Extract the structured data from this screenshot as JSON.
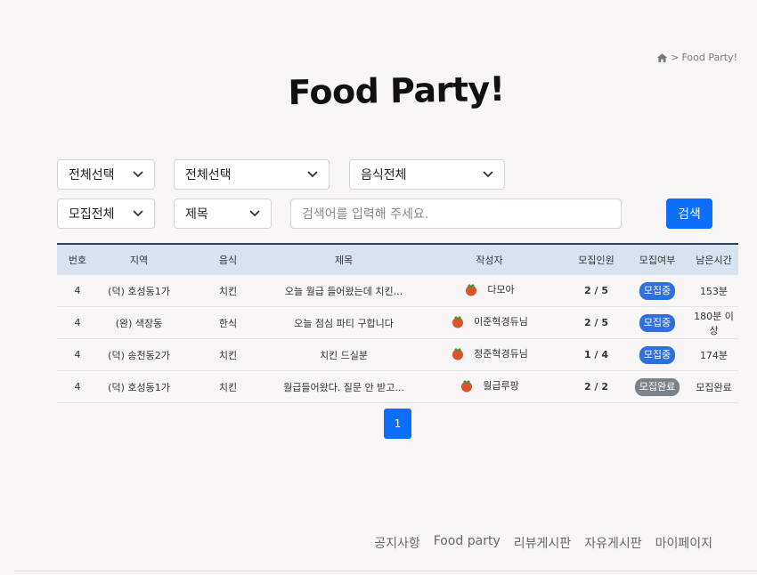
{
  "breadcrumb": {
    "separator": ">",
    "current": "Food Party!"
  },
  "page_title": "Food Party!",
  "filters": {
    "region1": "전체선택",
    "region2": "전체선택",
    "food": "음식전체",
    "recruit": "모집전체",
    "search_field": "제목",
    "search_placeholder": "검색어를 입력해 주세요.",
    "search_button": "검색"
  },
  "table": {
    "headers": [
      "번호",
      "지역",
      "음식",
      "제목",
      "작성자",
      "모집인원",
      "모집여부",
      "남은시간"
    ],
    "rows": [
      {
        "no": "4",
        "region": "(덕) 호성동1가",
        "food": "치킨",
        "title": "오늘 월급 들어왔는데 치킨...",
        "author": "다모아",
        "count": "2 / 5",
        "status": "모집중",
        "remaining": "153분"
      },
      {
        "no": "4",
        "region": "(완) 색장동",
        "food": "한식",
        "title": "오늘 점심 파티 구합니다",
        "author": "이준혁경듀님",
        "count": "2 / 5",
        "status": "모집중",
        "remaining": "180분 이상"
      },
      {
        "no": "4",
        "region": "(덕) 송천동2가",
        "food": "치킨",
        "title": "치킨 드실분",
        "author": "정준혁경듀님",
        "count": "1 / 4",
        "status": "모집중",
        "remaining": "174분"
      },
      {
        "no": "4",
        "region": "(덕) 호성동1가",
        "food": "치킨",
        "title": "월급들어왔다. 질문 안 받고...",
        "author": "월급루팡",
        "count": "2 / 2",
        "status": "모집완료",
        "remaining": "모집완료"
      }
    ]
  },
  "pagination": {
    "current": "1"
  },
  "footer": {
    "links": [
      "공지사항",
      "Food party",
      "리뷰게시판",
      "자유게시판",
      "마이페이지"
    ]
  },
  "colors": {
    "primary": "#0d6efd",
    "badge_open": "#2f6fdf",
    "badge_closed": "#7b8289",
    "header_bg": "#d9e3f0"
  },
  "icons": {
    "breadcrumb": "home-icon",
    "dropdown": "chevron-down-icon",
    "author": "tomato-icon"
  }
}
